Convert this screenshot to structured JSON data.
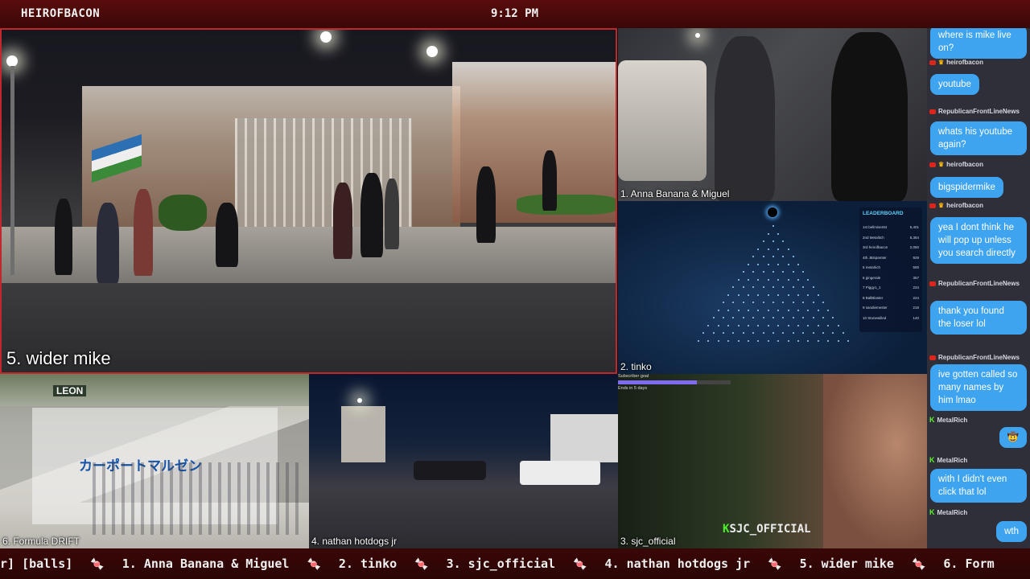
{
  "topbar": {
    "brand": "HEIROFBACON",
    "clock": "9:12 PM"
  },
  "tiles": [
    {
      "id": "t5",
      "label": "5. wider mike"
    },
    {
      "id": "t1",
      "label": "1. Anna Banana & Miguel"
    },
    {
      "id": "t2",
      "label": "2. tinko"
    },
    {
      "id": "t3",
      "label": "3. sjc_official"
    },
    {
      "id": "t4",
      "label": "4. nathan hotdogs jr"
    },
    {
      "id": "t6",
      "label": "6. Formula DRIFT"
    }
  ],
  "tile_overlays": {
    "leaderboard": {
      "title": "LEADERBOARD",
      "rows": [
        {
          "rank": "1st",
          "name": "bellmiser84",
          "score": "5,401"
        },
        {
          "rank": "2nd",
          "name": "Metalitch",
          "score": "5,384"
        },
        {
          "rank": "3rd",
          "name": "heirofbacon",
          "score": "2,050"
        },
        {
          "rank": "4th",
          "name": "JBSpamter",
          "score": "929"
        },
        {
          "rank": "5",
          "name": "metalrich",
          "score": "500"
        },
        {
          "rank": "6",
          "name": "gingerale",
          "score": "357"
        },
        {
          "rank": "7",
          "name": "Piggy1_1",
          "score": "234"
        },
        {
          "rank": "8",
          "name": "BallBlaster",
          "score": "224"
        },
        {
          "rank": "9",
          "name": "sandiemester",
          "score": "218"
        },
        {
          "rank": "10",
          "name": "Stonewilled",
          "score": "140"
        }
      ]
    },
    "sjc": {
      "watermark_k": "K",
      "watermark_text": "SJC_OFFICIAL",
      "subgoal": "Subscriber goal",
      "subgoal_ends": "Ends in 5 days"
    },
    "drift": {
      "banner_brand": "LEON",
      "banner_text": "カーポートマルゼン"
    }
  },
  "chat": {
    "messages": [
      {
        "kind": "bubble",
        "side": "right",
        "text": "where is mike live on?"
      },
      {
        "kind": "head",
        "platform": "youtube",
        "badge": "crown",
        "user": "heirofbacon"
      },
      {
        "kind": "bubble",
        "side": "left",
        "text": "youtube"
      },
      {
        "kind": "head",
        "platform": "youtube",
        "badge": "",
        "user": "RepublicanFrontLineNews"
      },
      {
        "kind": "bubble",
        "side": "right",
        "text": "whats his youtube again?"
      },
      {
        "kind": "head",
        "platform": "youtube",
        "badge": "crown",
        "user": "heirofbacon"
      },
      {
        "kind": "bubble",
        "side": "left",
        "text": "bigspidermike"
      },
      {
        "kind": "head",
        "platform": "youtube",
        "badge": "crown",
        "user": "heirofbacon"
      },
      {
        "kind": "bubble",
        "side": "left",
        "text": "yea I dont think he will pop up unless you search directly"
      },
      {
        "kind": "head",
        "platform": "youtube",
        "badge": "",
        "user": "RepublicanFrontLineNews"
      },
      {
        "kind": "bubble",
        "side": "right",
        "text": "thank you found the loser lol"
      },
      {
        "kind": "head",
        "platform": "youtube",
        "badge": "",
        "user": "RepublicanFrontLineNews"
      },
      {
        "kind": "bubble",
        "side": "right",
        "text": "ive gotten called so many names by him lmao"
      },
      {
        "kind": "head",
        "platform": "kick",
        "badge": "K",
        "user": "MetalRich"
      },
      {
        "kind": "bubble",
        "side": "right",
        "text": "🤠"
      },
      {
        "kind": "head",
        "platform": "kick",
        "badge": "K",
        "user": "MetalRich"
      },
      {
        "kind": "bubble",
        "side": "right",
        "text": "with I didn't even click that lol"
      },
      {
        "kind": "head",
        "platform": "kick",
        "badge": "K",
        "user": "MetalRich"
      },
      {
        "kind": "bubble",
        "side": "right",
        "text": "wth"
      }
    ]
  },
  "ticker": {
    "items": [
      "r] [balls]",
      "1. Anna Banana & Miguel",
      "2. tinko",
      "3. sjc_official",
      "4. nathan hotdogs jr",
      "5. wider mike",
      "6. Form"
    ],
    "separator": "🍬"
  },
  "colors": {
    "accent": "#c0282d",
    "bubble": "#3ea4ef",
    "topbar": "#4a0a0a",
    "chat_bg": "#2e2f38",
    "kick_green": "#5ef22d"
  }
}
